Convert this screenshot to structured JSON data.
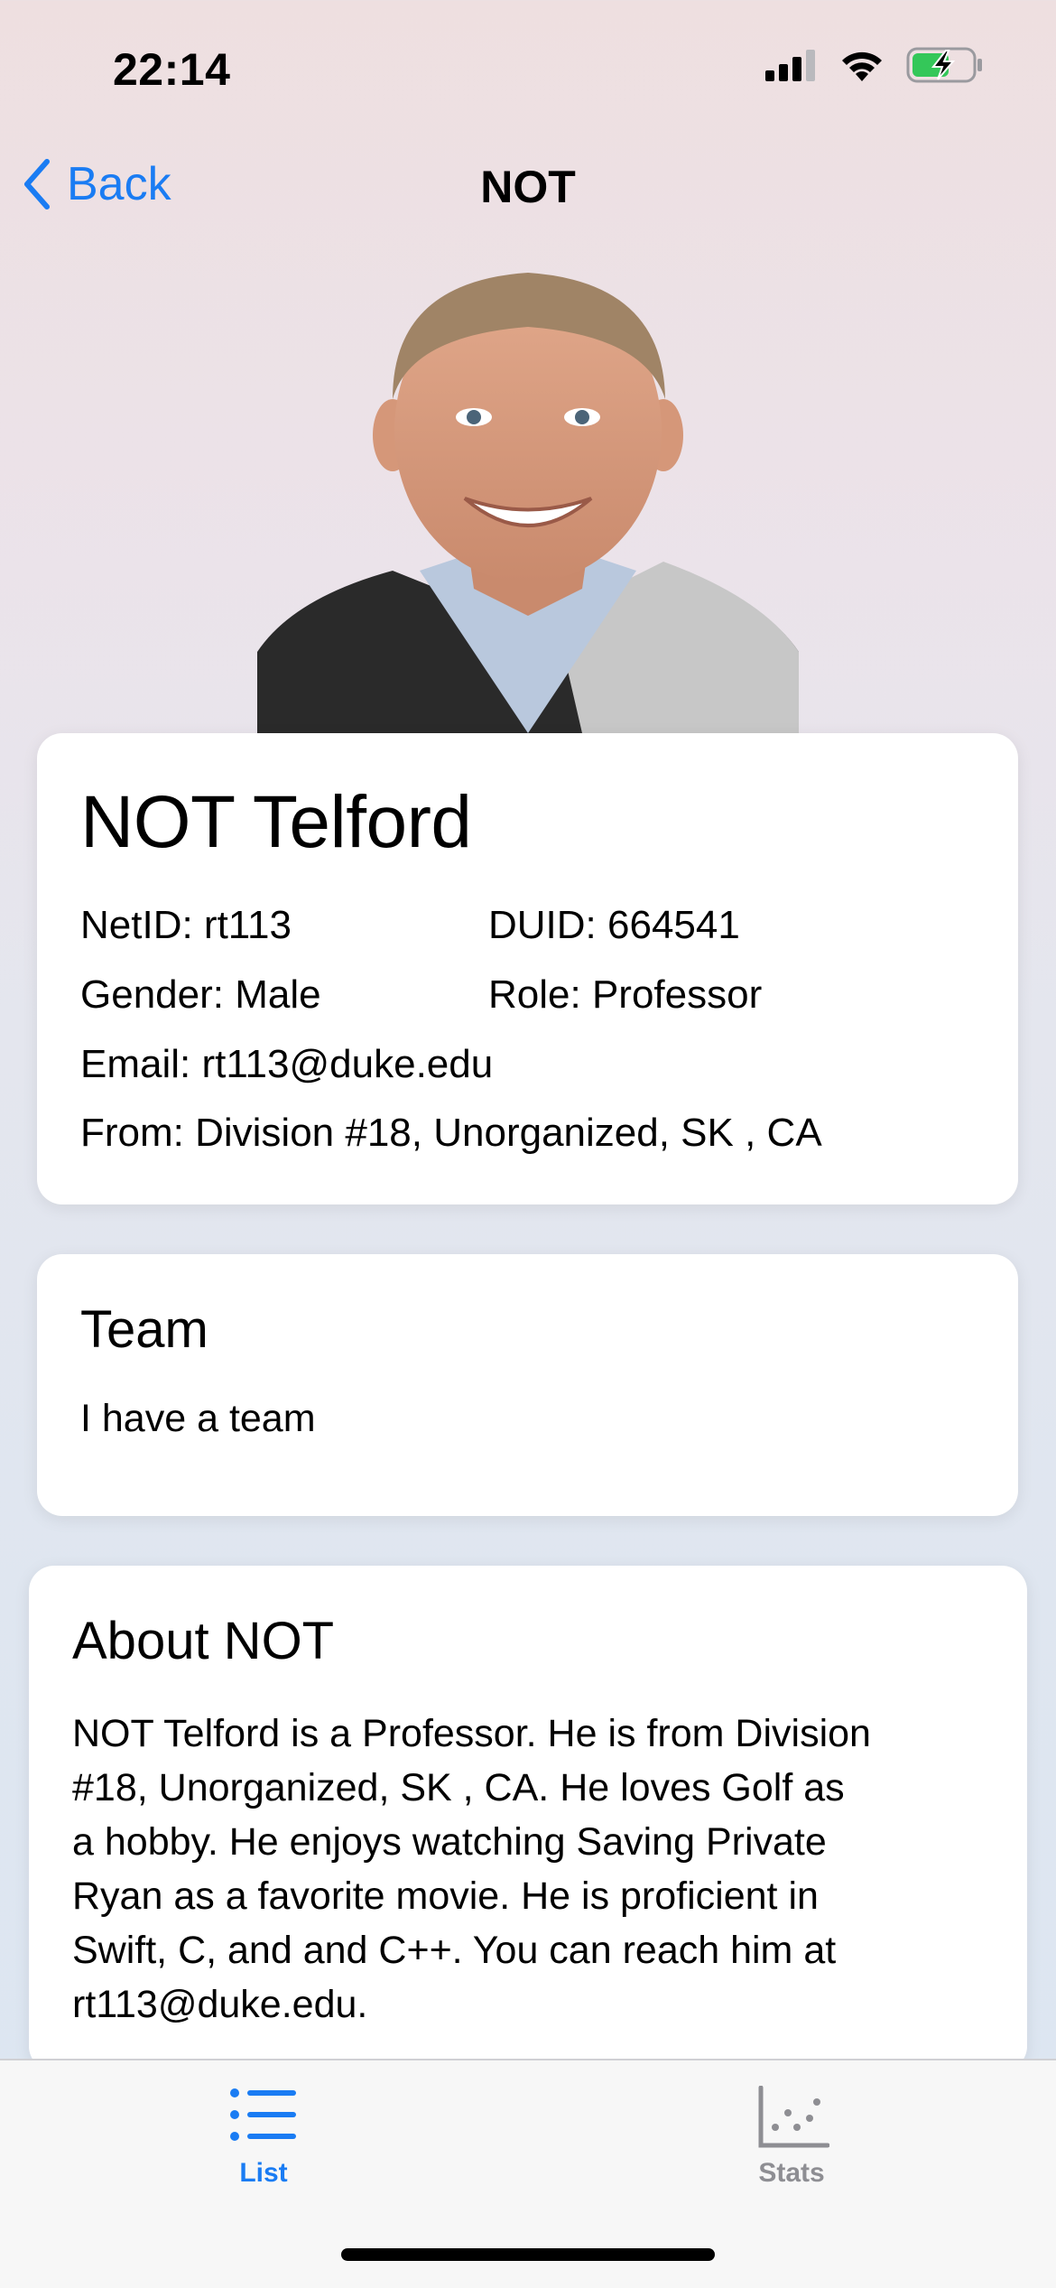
{
  "status_bar": {
    "time": "22:14",
    "battery_level": 0.6
  },
  "nav": {
    "back_label": "Back",
    "title": "NOT"
  },
  "profile": {
    "photo_alt": "Portrait of NOT Telford",
    "full_name": "NOT Telford",
    "netid": "NetID: rt113",
    "duid": "DUID: 664541",
    "gender": "Gender: Male",
    "role": "Role: Professor",
    "email": "Email: rt113@duke.edu",
    "from": "From: Division #18, Unorganized, SK , CA"
  },
  "team": {
    "title": "Team",
    "text": "I have a team"
  },
  "about": {
    "title": "About NOT",
    "lines": [
      "NOT Telford is a Professor. He is from Division",
      "#18, Unorganized, SK , CA.  He loves Golf as",
      "a hobby.  He enjoys watching Saving Private",
      "Ryan as a favorite movie.  He is proficient in",
      "Swift,   C,  and  and C++. You can reach him at",
      "rt113@duke.edu."
    ]
  },
  "tabs": [
    {
      "label": "List",
      "icon": "list-icon",
      "selected": true
    },
    {
      "label": "Stats",
      "icon": "scatter-chart-icon",
      "selected": false
    }
  ],
  "colors": {
    "accent": "#1a7cf3",
    "inactive": "#8e8e93",
    "battery_green": "#34c759"
  }
}
